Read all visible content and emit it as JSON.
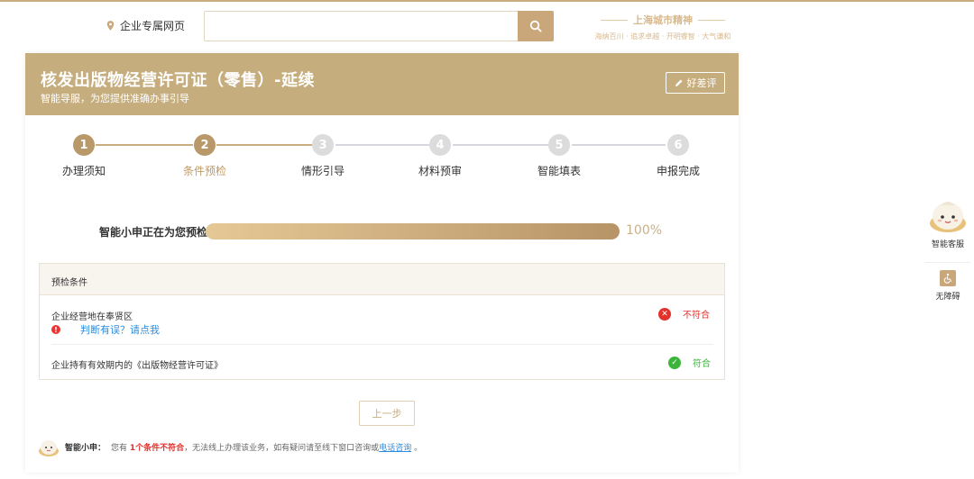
{
  "topbar": {
    "location_label": "企业专属网页",
    "search_placeholder": "",
    "slogan_title": "上海城市精神",
    "slogan_sub": "海纳百川 · 追求卓越 · 开明睿智 · 大气谦和"
  },
  "header": {
    "title": "核发出版物经营许可证（零售）-延续",
    "subtitle": "智能导服，为您提供准确办事引导",
    "rate_button": "好差评"
  },
  "steps": [
    {
      "num": "1",
      "label": "办理须知",
      "state": "done"
    },
    {
      "num": "2",
      "label": "条件预检",
      "state": "current"
    },
    {
      "num": "3",
      "label": "情形引导",
      "state": "todo"
    },
    {
      "num": "4",
      "label": "材料预审",
      "state": "todo"
    },
    {
      "num": "5",
      "label": "智能填表",
      "state": "todo"
    },
    {
      "num": "6",
      "label": "申报完成",
      "state": "todo"
    }
  ],
  "progress": {
    "label": "智能小申正在为您预检",
    "value": 1.0,
    "percent_text": "100%"
  },
  "precheck": {
    "header": "预检条件",
    "rows": [
      {
        "condition": "企业经营地在奉贤区",
        "status": "不符合",
        "ok": false,
        "note": "判断有误？请点我"
      },
      {
        "condition": "企业持有有效期内的《出版物经营许可证》",
        "status": "符合",
        "ok": true
      }
    ]
  },
  "prev_button": "上一步",
  "footer": {
    "bot_name": "智能小申：",
    "text1": "您有",
    "highlight": "1个条件不符合",
    "text2": "，无法线上办理该业务，如有疑问请至线下窗口咨询或",
    "link": "电话咨询",
    "text3": "。"
  },
  "side": {
    "service_label": "智能客服",
    "access_label": "无障碍"
  },
  "colors": {
    "gold": "#c6ad7e",
    "error": "#e3312b",
    "success": "#3ab53a",
    "link": "#2c8de0"
  }
}
